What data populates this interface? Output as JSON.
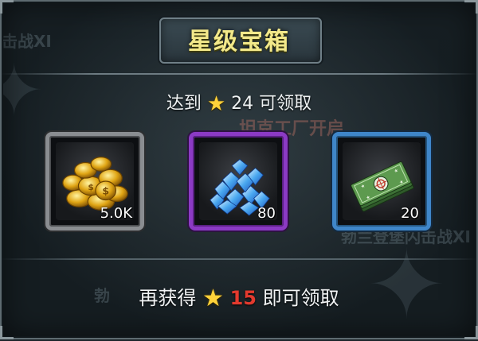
{
  "dialog": {
    "title": "星级宝箱",
    "requirement": {
      "prefix": "达到",
      "stars": "24",
      "suffix": "可领取"
    },
    "rewards": [
      {
        "name": "gold-coins",
        "icon": "gold-coins-icon",
        "amount": "5.0K",
        "rarity_color": "#8a8d91"
      },
      {
        "name": "diamonds",
        "icon": "diamonds-icon",
        "amount": "80",
        "rarity_color": "#8b3ac4"
      },
      {
        "name": "banknotes",
        "icon": "banknotes-icon",
        "amount": "20",
        "rarity_color": "#3f86c9"
      }
    ],
    "remaining": {
      "prefix": "再获得",
      "stars": "15",
      "suffix": "即可领取"
    }
  },
  "background": {
    "texts": [
      "击战XI",
      "坦克工厂开启",
      "勃兰登堡闪击战XI",
      "勃"
    ]
  },
  "colors": {
    "title": "#f3e98a",
    "star": "#ffd23a",
    "highlight_number": "#e33a2e"
  }
}
